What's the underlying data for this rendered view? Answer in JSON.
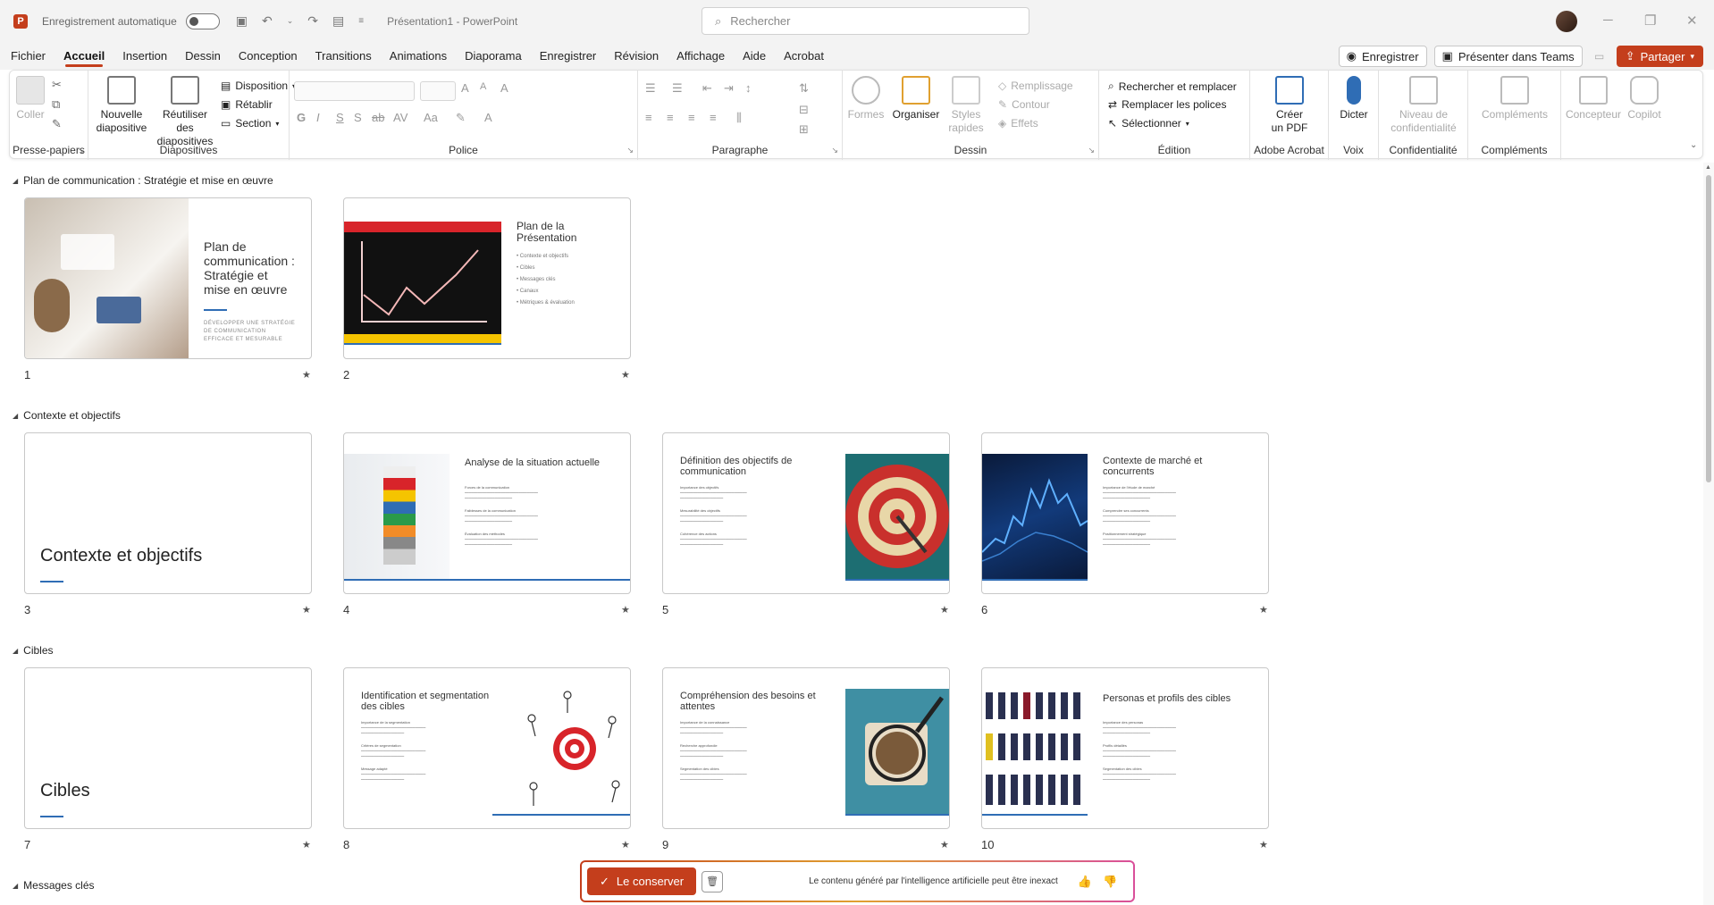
{
  "titlebar": {
    "autosave_label": "Enregistrement automatique",
    "doc_title": "Présentation1 - PowerPoint",
    "search_placeholder": "Rechercher"
  },
  "tabs": [
    "Fichier",
    "Accueil",
    "Insertion",
    "Dessin",
    "Conception",
    "Transitions",
    "Animations",
    "Diaporama",
    "Enregistrer",
    "Révision",
    "Affichage",
    "Aide",
    "Acrobat"
  ],
  "active_tab": "Accueil",
  "tab_actions": {
    "record": "Enregistrer",
    "present": "Présenter dans Teams",
    "share": "Partager"
  },
  "ribbon": {
    "clipboard": {
      "paste": "Coller",
      "label": "Presse-papiers"
    },
    "slides": {
      "new_slide_1": "Nouvelle",
      "new_slide_2": "diapositive",
      "reuse_1": "Réutiliser des",
      "reuse_2": "diapositives",
      "layout": "Disposition",
      "reset": "Rétablir",
      "section": "Section",
      "label": "Diapositives"
    },
    "font": {
      "label": "Police"
    },
    "paragraph": {
      "label": "Paragraphe"
    },
    "drawing": {
      "shapes": "Formes",
      "arrange": "Organiser",
      "styles_1": "Styles",
      "styles_2": "rapides",
      "fill": "Remplissage",
      "outline": "Contour",
      "effects": "Effets",
      "label": "Dessin"
    },
    "editing": {
      "find_replace": "Rechercher et remplacer",
      "replace_fonts": "Remplacer les polices",
      "select": "Sélectionner",
      "label": "Édition"
    },
    "acrobat": {
      "create_1": "Créer",
      "create_2": "un PDF",
      "label": "Adobe Acrobat"
    },
    "voice": {
      "dictate": "Dicter",
      "label": "Voix"
    },
    "privacy": {
      "level_1": "Niveau de",
      "level_2": "confidentialité",
      "label": "Confidentialité"
    },
    "addins": {
      "addins": "Compléments",
      "label": "Compléments"
    },
    "designer": "Concepteur",
    "copilot": "Copilot"
  },
  "sections": [
    {
      "title": "Plan de communication : Stratégie et mise en œuvre"
    },
    {
      "title": "Contexte et objectifs"
    },
    {
      "title": "Cibles"
    },
    {
      "title": "Messages clés"
    }
  ],
  "slides": [
    {
      "num": "1",
      "title_lines": [
        "Plan de",
        "communication :",
        "Stratégie et",
        "mise en œuvre"
      ],
      "subtitle_lines": [
        "DÉVELOPPER UNE STRATÉGIE",
        "DE COMMUNICATION",
        "EFFICACE ET MESURABLE"
      ]
    },
    {
      "num": "2",
      "title_lines": [
        "Plan de la",
        "Présentation"
      ],
      "bullets": [
        "Contexte et objectifs",
        "Cibles",
        "Messages clés",
        "Canaux",
        "Métriques & évaluation"
      ]
    },
    {
      "num": "3",
      "title": "Contexte et objectifs"
    },
    {
      "num": "4",
      "title": "Analyse de la situation actuelle",
      "headings": [
        "Forces de la communication",
        "Faiblesses de la communication",
        "Évaluation des méthodes"
      ]
    },
    {
      "num": "5",
      "title_lines": [
        "Définition des objectifs de",
        "communication"
      ],
      "headings": [
        "Importance des objectifs",
        "Mesurabilité des objectifs",
        "Cohérence des actions"
      ]
    },
    {
      "num": "6",
      "title_lines": [
        "Contexte de marché et",
        "concurrents"
      ],
      "headings": [
        "Importance de l'étude de marché",
        "Comprendre ses concurrents",
        "Positionnement stratégique"
      ]
    },
    {
      "num": "7",
      "title": "Cibles"
    },
    {
      "num": "8",
      "title_lines": [
        "Identification et segmentation",
        "des cibles"
      ],
      "headings": [
        "Importance de la segmentation",
        "Critères de segmentation",
        "Message adapté"
      ]
    },
    {
      "num": "9",
      "title_lines": [
        "Compréhension des besoins et",
        "attentes"
      ],
      "headings": [
        "Importance de la connaissance",
        "Recherche approfondie",
        "Segmentation des cibles"
      ]
    },
    {
      "num": "10",
      "title": "Personas et profils des cibles",
      "headings": [
        "Importance des personas",
        "Profils détaillés",
        "Segmentation des cibles"
      ]
    }
  ],
  "ai_bar": {
    "keep": "Le conserver",
    "note": "Le contenu généré par l'intelligence artificielle peut être inexact"
  },
  "colors": {
    "accent": "#c43e1c",
    "blue": "#2f6db5"
  }
}
